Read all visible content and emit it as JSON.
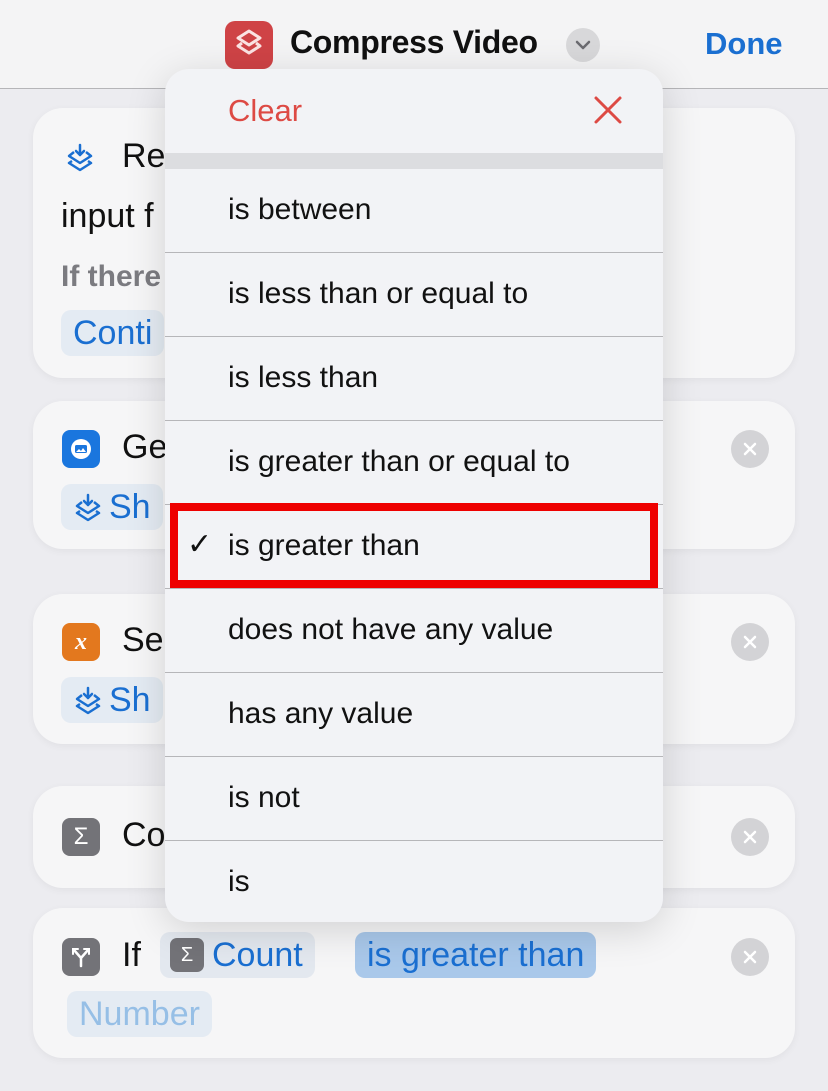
{
  "navbar": {
    "title": "Compress Video",
    "done_label": "Done",
    "app_icon": "shortcuts-icon",
    "title_menu_icon": "chevron-down-icon"
  },
  "cards": [
    {
      "icon": "receive-input-icon",
      "title_visible": "Re",
      "line2_visible": "input f",
      "subtitle_visible": "If there",
      "token_visible": "Conti"
    },
    {
      "icon": "photo-icon",
      "title_visible": "Ge",
      "token_visible": "Sh"
    },
    {
      "icon": "variable-icon",
      "title_visible": "Se",
      "token_visible": "Sh"
    },
    {
      "icon": "sigma-icon",
      "title_visible": "Co"
    },
    {
      "icon": "branch-icon",
      "title": "If",
      "variable_token": "Count",
      "condition_token": "is greater than",
      "value_placeholder": "Number"
    }
  ],
  "menu": {
    "clear_label": "Clear",
    "items": [
      {
        "label": "is between",
        "selected": false
      },
      {
        "label": "is less than or equal to",
        "selected": false
      },
      {
        "label": "is less than",
        "selected": false
      },
      {
        "label": "is greater than or equal to",
        "selected": false
      },
      {
        "label": "is greater than",
        "selected": true
      },
      {
        "label": "does not have any value",
        "selected": false
      },
      {
        "label": "has any value",
        "selected": false
      },
      {
        "label": "is not",
        "selected": false
      },
      {
        "label": "is",
        "selected": false
      }
    ],
    "check_glyph": "✓"
  },
  "colors": {
    "accent_blue": "#1a6fd1",
    "destructive_red": "#dd4a44",
    "highlight_box": "#ee0000",
    "app_icon_red": "#cf4346"
  }
}
